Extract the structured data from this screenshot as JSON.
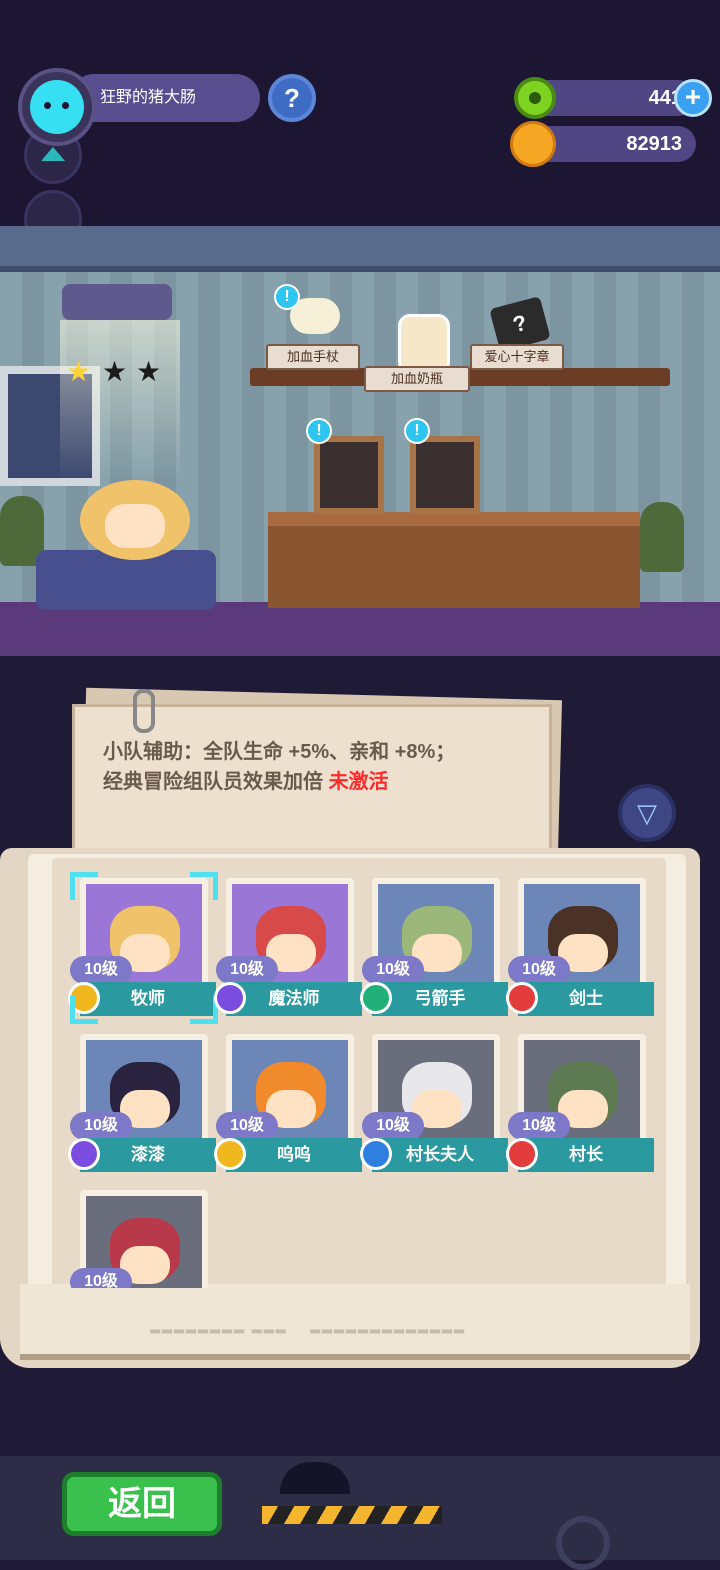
{
  "hud": {
    "player_name": "狂野的猪大肠",
    "help_label": "?",
    "gems": "441",
    "plus_label": "+",
    "coins": "82913"
  },
  "room": {
    "items": [
      {
        "label": "加血手杖"
      },
      {
        "label": "加血奶瓶"
      },
      {
        "label": "爱心十字章"
      }
    ],
    "stars_filled": 1,
    "stars_total": 3,
    "notice_mark": "!"
  },
  "note": {
    "line1": "小队辅助：全队生命 +5%、亲和 +8%；",
    "line2": "经典冒险组队员效果加倍 ",
    "status": "未激活"
  },
  "filter_icon": "filter-icon",
  "cards": [
    {
      "level": "10级",
      "name": "牧师",
      "class_color": "#f0b81e",
      "bg": "#9a77d6",
      "hair": "#f0c26a",
      "selected": true
    },
    {
      "level": "10级",
      "name": "魔法师",
      "class_color": "#7a4de0",
      "bg": "#9a77d6",
      "hair": "#d84a4a"
    },
    {
      "level": "10级",
      "name": "弓箭手",
      "class_color": "#22b07a",
      "bg": "#6d86b8",
      "hair": "#9bb77a"
    },
    {
      "level": "10级",
      "name": "剑士",
      "class_color": "#e23c3c",
      "bg": "#6d86b8",
      "hair": "#4a3226"
    },
    {
      "level": "10级",
      "name": "漆漆",
      "class_color": "#7a4de0",
      "bg": "#6d86b8",
      "hair": "#2a2340"
    },
    {
      "level": "10级",
      "name": "呜呜",
      "class_color": "#f0b81e",
      "bg": "#6d86b8",
      "hair": "#f08a2a"
    },
    {
      "level": "10级",
      "name": "村长夫人",
      "class_color": "#2f7fe0",
      "bg": "#6a6e7c",
      "hair": "#e8e8ea"
    },
    {
      "level": "10级",
      "name": "村长",
      "class_color": "#e23c3c",
      "bg": "#6a6e7c",
      "hair": "#5e7a52"
    },
    {
      "level": "10级",
      "name": "",
      "class_color": "#7a4de0",
      "bg": "#6a6e7c",
      "hair": "#b83a4a",
      "partial": true
    }
  ],
  "bottom": {
    "back_label": "返回"
  }
}
